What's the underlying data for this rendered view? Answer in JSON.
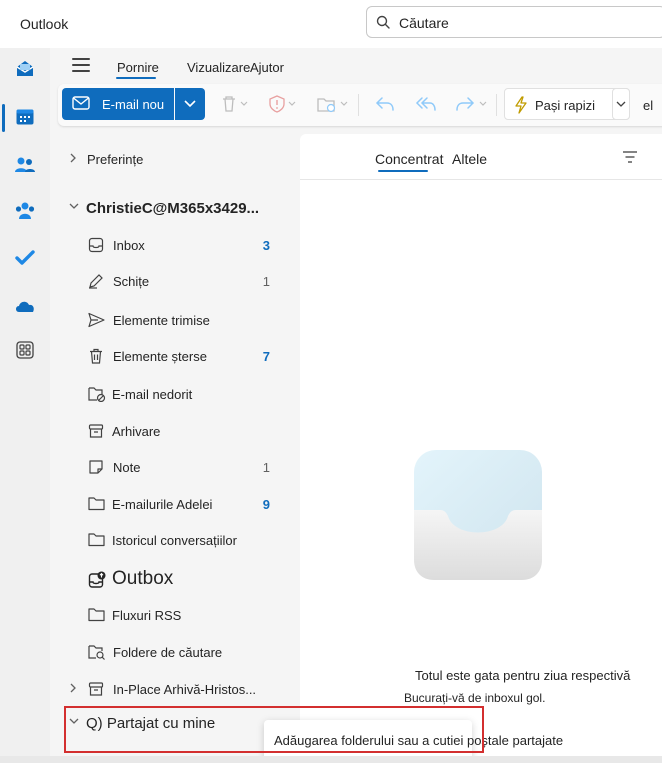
{
  "app": {
    "title": "Outlook"
  },
  "search": {
    "placeholder": "Căutare"
  },
  "ribbon": {
    "tabs": [
      {
        "label": "Pornire",
        "active": true
      },
      {
        "label": "Vizualizare",
        "active": false
      },
      {
        "label": "Ajutor",
        "active": false
      }
    ]
  },
  "toolbar": {
    "new_mail_label": "E-mail nou",
    "quick_steps_label": "Pași rapizi",
    "overflow_label": "el"
  },
  "folders": {
    "preferences_label": "Preferințe",
    "account_label": "ChristieC@M365x3429...",
    "items": [
      {
        "label": "Inbox",
        "count": "3",
        "count_style": "bold",
        "icon": "inbox-icon"
      },
      {
        "label": "Schițe",
        "count": "1",
        "count_style": "light",
        "icon": "drafts-icon"
      },
      {
        "label": "Elemente trimise",
        "count": "",
        "count_style": "",
        "icon": "sent-icon"
      },
      {
        "label": "Elemente șterse",
        "count": "7",
        "count_style": "bold",
        "icon": "trash-icon"
      },
      {
        "label": "E-mail nedorit",
        "count": "",
        "count_style": "",
        "icon": "junk-folder-icon"
      },
      {
        "label": "Arhivare",
        "count": "",
        "count_style": "",
        "icon": "archive-icon"
      },
      {
        "label": "Note",
        "count": "1",
        "count_style": "light",
        "icon": "note-icon"
      },
      {
        "label": "E-mailurile Adelei",
        "count": "9",
        "count_style": "bold",
        "icon": "folder-icon"
      },
      {
        "label": "Istoricul conversațiilor",
        "count": "",
        "count_style": "",
        "icon": "folder-icon"
      },
      {
        "label": "Outbox",
        "count": "",
        "count_style": "",
        "icon": "outbox-icon"
      },
      {
        "label": "Fluxuri RSS",
        "count": "",
        "count_style": "",
        "icon": "folder-icon"
      },
      {
        "label": "Foldere de căutare",
        "count": "",
        "count_style": "",
        "icon": "search-folder-icon"
      }
    ],
    "in_place_archive_label": "In-Place Arhivă-Hristos...",
    "shared_label": "Q) Partajat cu mine"
  },
  "message_list": {
    "focused_tab": "Concentrat",
    "other_tab": "Altele",
    "empty_title": "Totul este gata pentru ziua respectivă",
    "empty_subtitle": "Bucurați-vă de inboxul gol."
  },
  "tooltip": {
    "text": "Adăugarea folderului sau a cutiei poștale partajate"
  },
  "colors": {
    "accent": "#0f6cbd",
    "highlight_border": "#d32f2f"
  }
}
